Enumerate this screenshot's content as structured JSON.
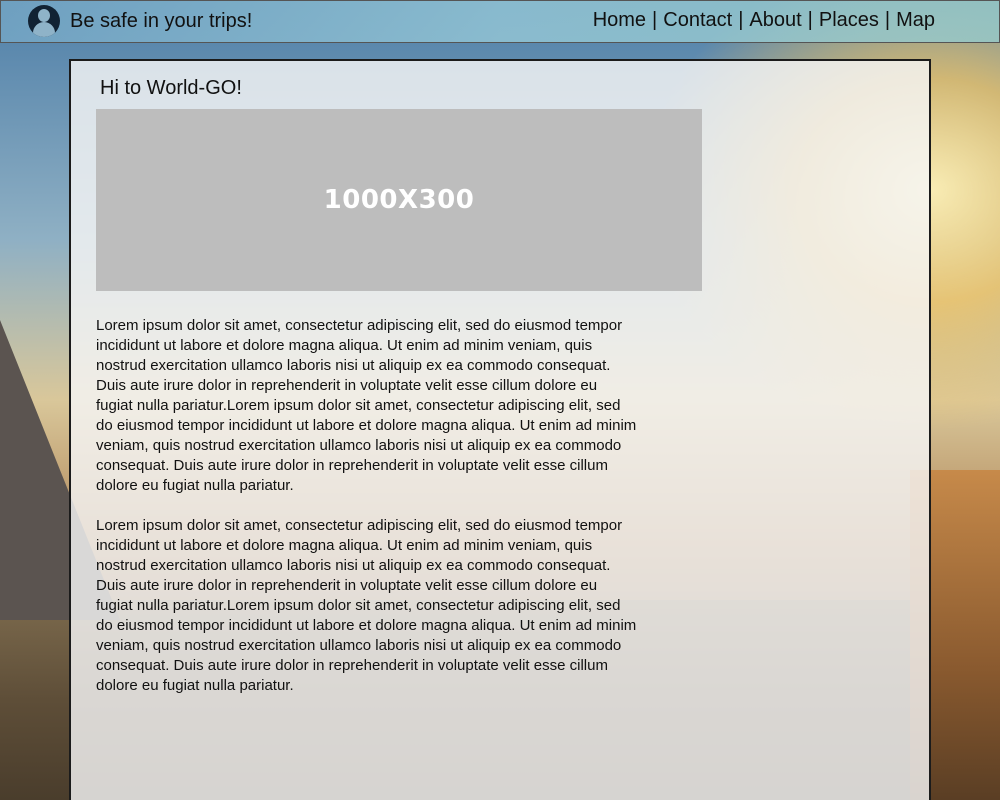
{
  "header": {
    "brand_text": "Be safe in your trips!",
    "logo_icon": "hiker-logo-icon",
    "nav": [
      {
        "label": "Home"
      },
      {
        "label": "Contact"
      },
      {
        "label": "About"
      },
      {
        "label": "Places"
      },
      {
        "label": "Map"
      }
    ],
    "separator": "|"
  },
  "main": {
    "greeting": "Hi to World-GO!",
    "image_placeholder_text": "1000X300",
    "paragraphs": [
      "Lorem ipsum dolor sit amet, consectetur adipiscing elit, sed do eiusmod tempor\n incididunt ut labore et dolore magna aliqua. Ut enim ad minim veniam, quis\nnostrud exercitation ullamco laboris nisi ut aliquip ex ea commodo consequat.\nDuis aute irure dolor in reprehenderit in voluptate velit esse cillum dolore eu\nfugiat nulla pariatur.Lorem ipsum dolor sit amet, consectetur adipiscing elit, sed\n do eiusmod tempor incididunt ut labore et dolore magna aliqua. Ut enim ad minim\nveniam, quis nostrud exercitation ullamco laboris nisi ut aliquip ex ea commodo\nconsequat. Duis aute irure dolor in reprehenderit in voluptate velit esse cillum\ndolore eu fugiat nulla pariatur.",
      "Lorem ipsum dolor sit amet, consectetur adipiscing elit, sed do eiusmod tempor\n incididunt ut labore et dolore magna aliqua. Ut enim ad minim veniam, quis\nnostrud exercitation ullamco laboris nisi ut aliquip ex ea commodo consequat.\nDuis aute irure dolor in reprehenderit in voluptate velit esse cillum dolore eu\nfugiat nulla pariatur.Lorem ipsum dolor sit amet, consectetur adipiscing elit, sed\n do eiusmod tempor incididunt ut labore et dolore magna aliqua. Ut enim ad minim\nveniam, quis nostrud exercitation ullamco laboris nisi ut aliquip ex ea commodo\nconsequat. Duis aute irure dolor in reprehenderit in voluptate velit esse cillum\ndolore eu fugiat nulla pariatur."
    ]
  },
  "colors": {
    "panel_border": "#1b1b1b",
    "placeholder_bg": "#bdbdbd",
    "placeholder_text": "#ffffff"
  }
}
